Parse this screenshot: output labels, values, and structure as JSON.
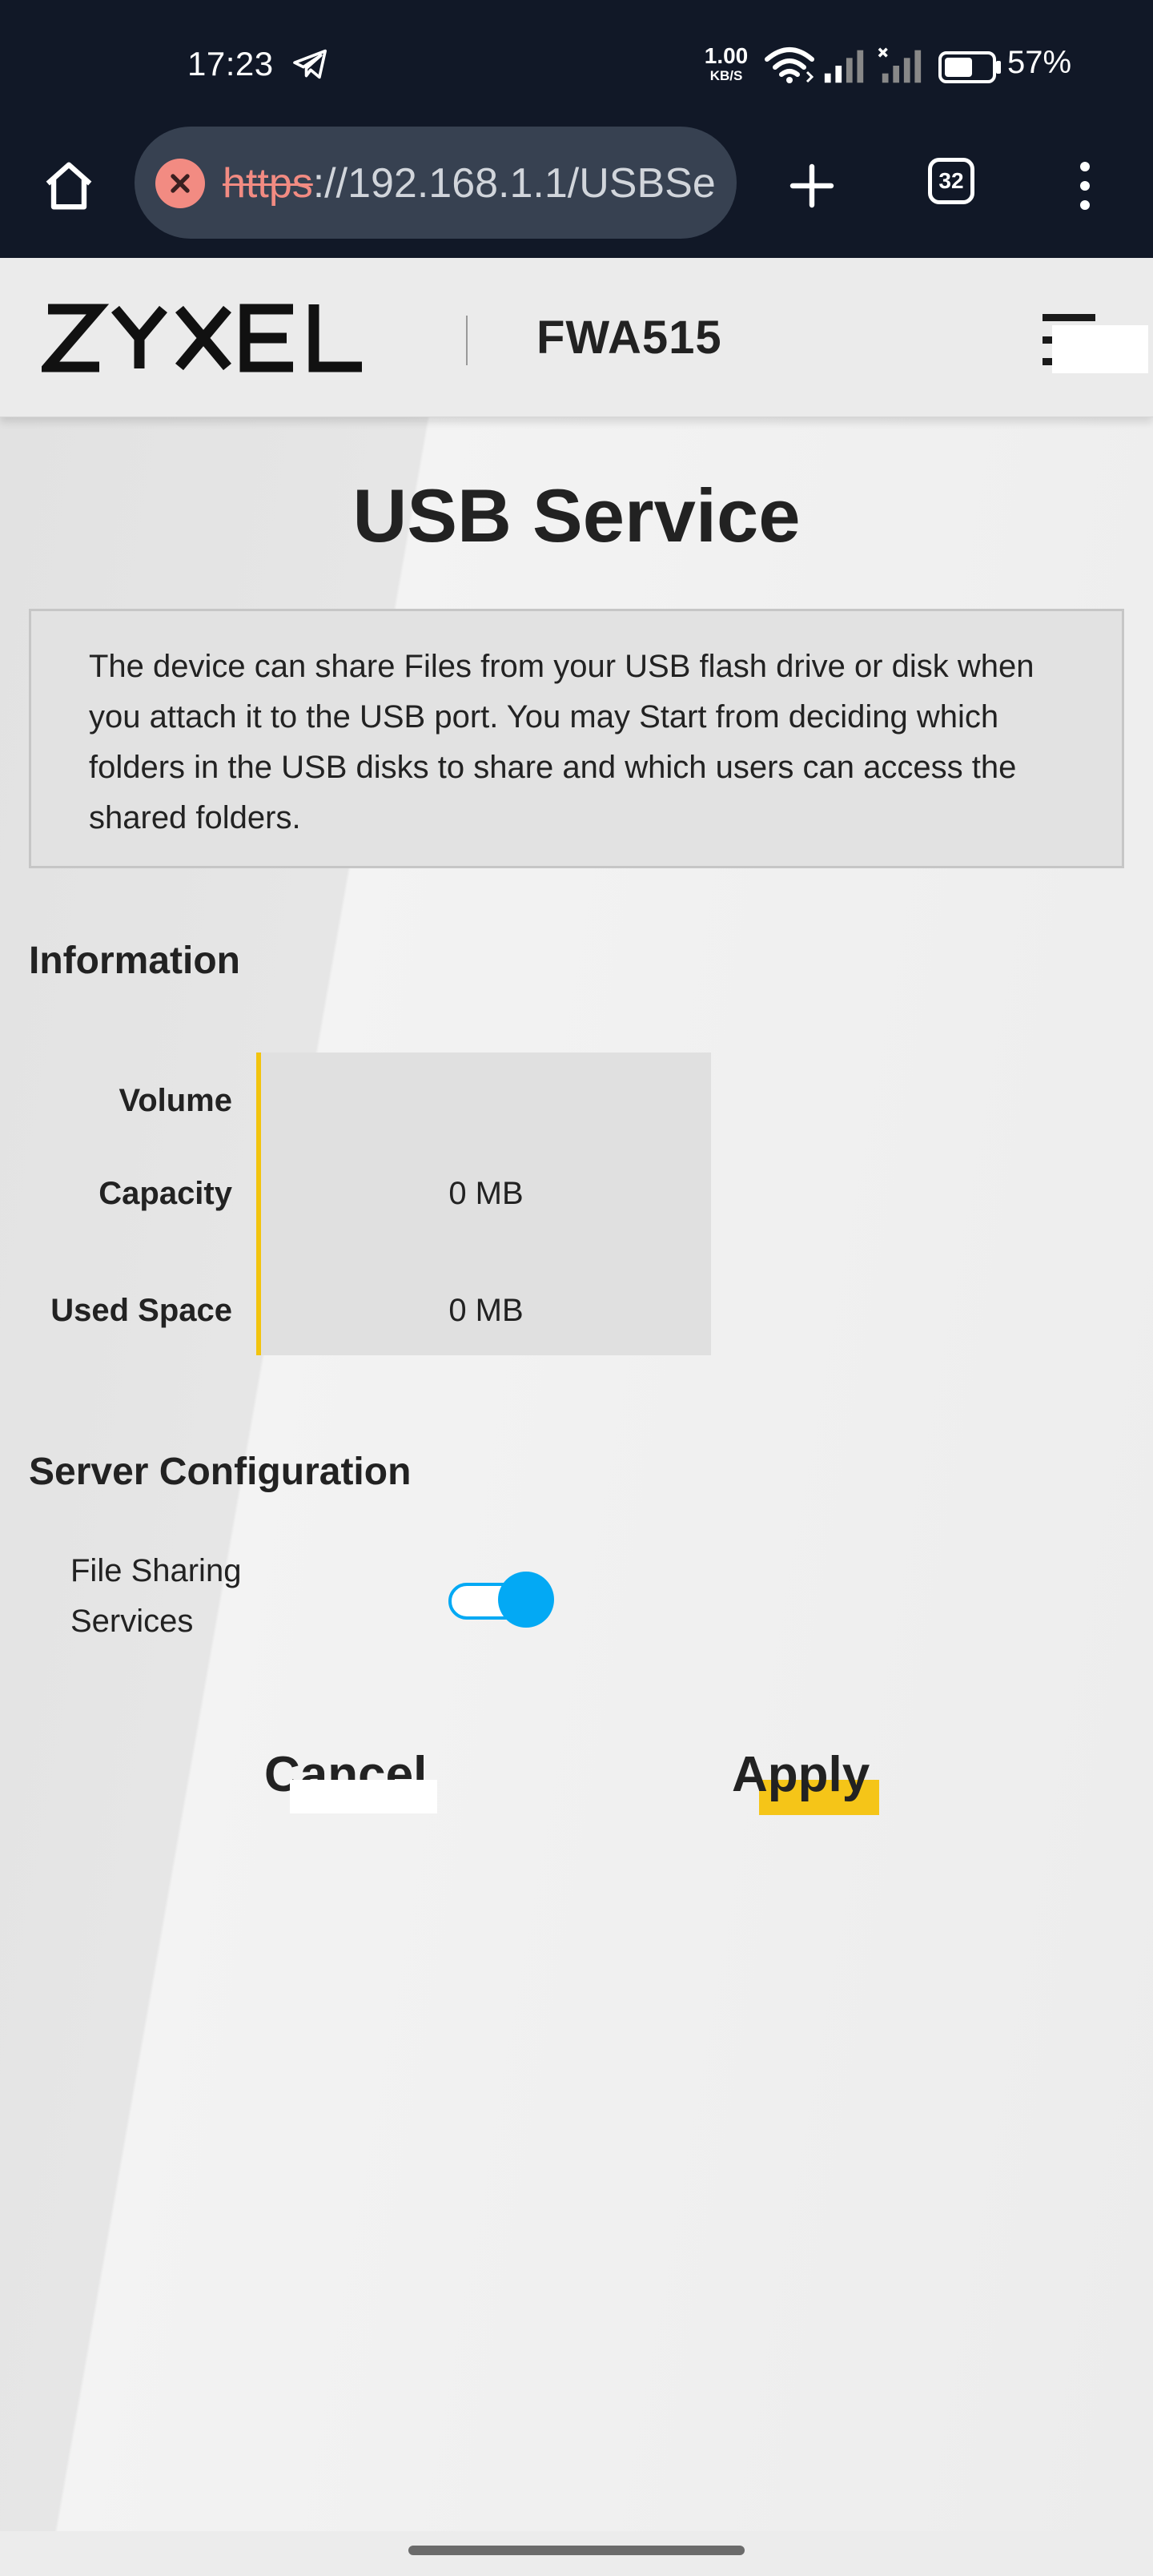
{
  "status_bar": {
    "time": "17:23",
    "net_speed_value": "1.00",
    "net_speed_unit": "KB/S",
    "battery_percent": "57%"
  },
  "browser": {
    "url_scheme": "https",
    "url_rest": "://192.168.1.1/USBSe",
    "tab_count": "32"
  },
  "header": {
    "logo_text": "ZYXEL",
    "model": "FWA515"
  },
  "page": {
    "title": "USB Service",
    "description": "The device can share Files from your USB flash drive or disk when you attach it to the USB port. You may Start from deciding which folders in the USB disks to share and which users can access the shared folders."
  },
  "information": {
    "heading": "Information",
    "rows": [
      {
        "label": "Volume",
        "value": ""
      },
      {
        "label": "Capacity",
        "value": "0 MB"
      },
      {
        "label": "Used Space",
        "value": "0 MB"
      }
    ]
  },
  "server_configuration": {
    "heading": "Server Configuration",
    "file_sharing_label": "File Sharing Services",
    "file_sharing_enabled": true
  },
  "actions": {
    "cancel_label": "Cancel",
    "apply_label": "Apply"
  },
  "colors": {
    "accent_yellow": "#f2c40f",
    "toggle_blue": "#03a9f4",
    "browser_bg": "#111827"
  }
}
